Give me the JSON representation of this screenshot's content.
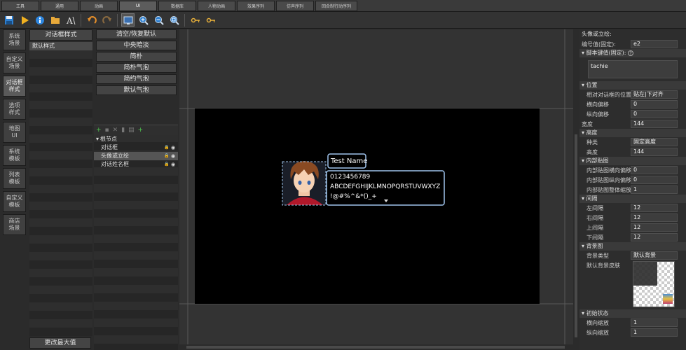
{
  "menu_tabs": [
    "工具",
    "通用",
    "动画",
    "UI",
    "数据库",
    "人物动画",
    "效果序列",
    "仿声序列",
    "回合制行动序列"
  ],
  "menu_active": 3,
  "toolbar_icons": [
    "save-icon",
    "play-icon",
    "info-icon",
    "folder-icon",
    "font-icon",
    "undo-icon",
    "redo-icon",
    "screen-icon",
    "zoom-in-icon",
    "zoom-out-icon",
    "zoom-reset-icon",
    "key-icon",
    "key-icon"
  ],
  "left_nav": [
    "系统\n场景",
    "自定义\n场景",
    "对话框\n样式",
    "选项\n样式",
    "地图\nUI",
    "系统\n模板",
    "列表\n模板",
    "自定义\n模板",
    "商店\n场景"
  ],
  "left_nav_active": 2,
  "style_panel": {
    "header": "对话框样式",
    "items": [
      "默认样式"
    ],
    "max_button": "更改最大值"
  },
  "presets": [
    "清空/恢复默认",
    "中央暗淡",
    "简朴",
    "简朴气泡",
    "简约气泡",
    "默认气泡"
  ],
  "tree": {
    "root": "根节点",
    "children": [
      "对话框",
      "头像或立绘",
      "对话姓名框"
    ],
    "selected": 1
  },
  "preview": {
    "name": "Test Name",
    "line1": "0123456789",
    "line2": "ABCDEFGHIJKLMNOPQRSTUVWXYZ",
    "line3": "!@#%^&*()_+",
    "hair_color": "#8a4a22",
    "coat_color": "#b0182a",
    "window_border": "#9fc4ec"
  },
  "props": {
    "title": "头像或立绘:",
    "id_label": "编号值(固定):",
    "id_value": "e2",
    "script_label": "脚本键值(固定):",
    "script_value": "tachie",
    "sec_position": "位置",
    "relative_label": "相对对话框的位置",
    "relative_value": "贴左|下对齐",
    "hoffset_label": "横向偏移",
    "hoffset_value": "0",
    "voffset_label": "纵向偏移",
    "voffset_value": "0",
    "width_label": "宽度",
    "width_value": "144",
    "sec_height": "高度",
    "htype_label": "种类",
    "htype_value": "固定高度",
    "height_label": "高度",
    "height_value": "144",
    "sec_inner": "内部贴图",
    "in_h_label": "内部贴图横向偏移",
    "in_h_value": "0",
    "in_v_label": "内部贴图纵向偏移",
    "in_v_value": "0",
    "in_s_label": "内部贴图整体缩放",
    "in_s_value": "1",
    "sec_padding": "间隔",
    "pl_label": "左间隔",
    "pl_value": "12",
    "pr_label": "右间隔",
    "pr_value": "12",
    "pt_label": "上间隔",
    "pt_value": "12",
    "pb_label": "下间隔",
    "pb_value": "12",
    "sec_bg": "背景图",
    "bgtype_label": "背景类型",
    "bgtype_value": "默认背景",
    "bgskin_label": "默认背景皮肤",
    "sec_init": "初始状态",
    "sx_label": "横向缩放",
    "sx_value": "1",
    "sy_label": "纵向缩放",
    "sy_value": "1"
  }
}
